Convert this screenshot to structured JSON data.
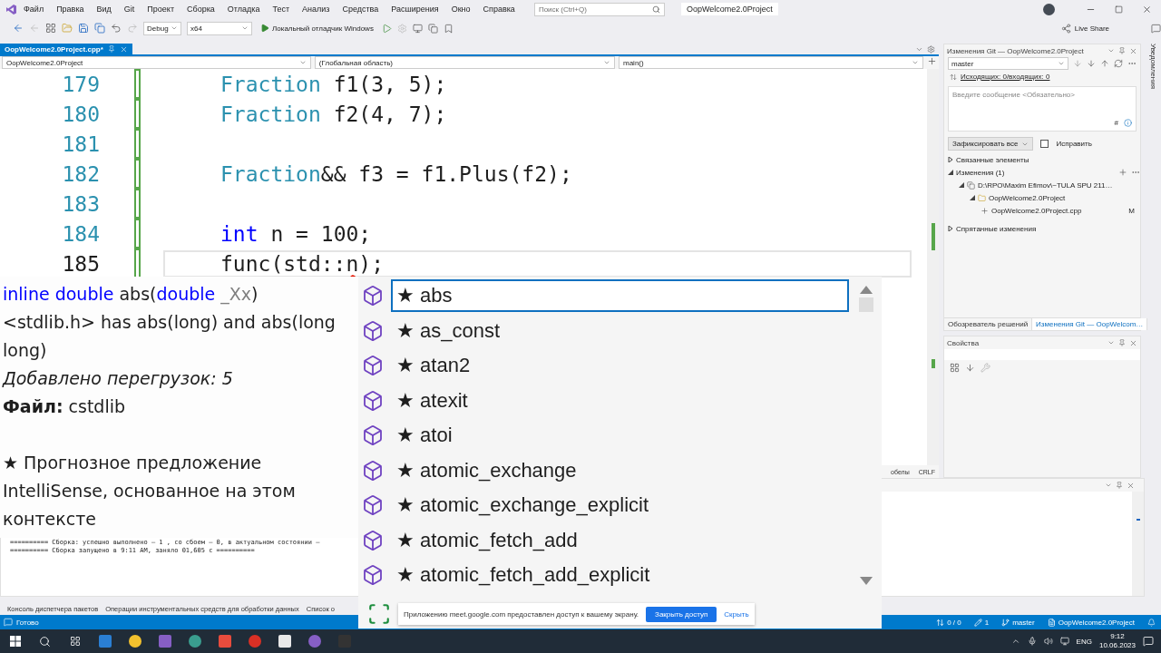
{
  "title_bar": {
    "menu": [
      "Файл",
      "Правка",
      "Вид",
      "Git",
      "Проект",
      "Сборка",
      "Отладка",
      "Тест",
      "Анализ",
      "Средства",
      "Расширения",
      "Окно",
      "Справка"
    ],
    "search": {
      "placeholder": "Поиск (Ctrl+Q)"
    },
    "project_title": "OopWelcome2.0Project"
  },
  "toolbar": {
    "configuration": "Debug",
    "platform": "x64",
    "run_target": "Локальный отладчик Windows",
    "live_share": "Live Share"
  },
  "editor": {
    "tab": {
      "label": "OopWelcome2.0Project.cpp*",
      "selected": true
    },
    "nav": [
      "OopWelcome2.0Project",
      "(Глобальная область)",
      "main()"
    ],
    "lines": [
      {
        "number": "179",
        "current": false,
        "tokens": [
          {
            "kind": "type",
            "text": "Fraction"
          },
          {
            "kind": "plain",
            "text": " f1(3, 5);"
          }
        ]
      },
      {
        "number": "180",
        "current": false,
        "tokens": [
          {
            "kind": "type",
            "text": "Fraction"
          },
          {
            "kind": "plain",
            "text": " f2(4, 7);"
          }
        ]
      },
      {
        "number": "181",
        "current": false
      },
      {
        "number": "182",
        "current": false,
        "tokens": [
          {
            "kind": "type",
            "text": "Fraction"
          },
          {
            "kind": "plain",
            "text": "&& f3 = f1.Plus(f2);"
          }
        ]
      },
      {
        "number": "183",
        "current": false
      },
      {
        "number": "184",
        "current": false,
        "tokens": [
          {
            "kind": "keyword",
            "text": "int"
          },
          {
            "kind": "plain",
            "text": " n = 100;"
          }
        ]
      },
      {
        "number": "185",
        "current": true,
        "tokens": [
          {
            "kind": "plain",
            "text": "func(std::"
          },
          {
            "kind": "error",
            "text": "n"
          },
          {
            "kind": "plain",
            "text": ");"
          }
        ]
      }
    ],
    "footer": [
      "обелы",
      "CRLF"
    ]
  },
  "intellisense": {
    "signature": [
      {
        "kind": "keyword",
        "text": "inline double"
      },
      {
        "kind": "name",
        "text": " abs("
      },
      {
        "kind": "keyword",
        "text": "double"
      },
      {
        "kind": "param",
        "text": " _Xx"
      },
      {
        "kind": "name",
        "text": ")"
      }
    ],
    "description": "<stdlib.h> has abs(long) and abs(long long)",
    "overloads": "Добавлено перегрузок: 5",
    "file": "**Файл:** cstdlib",
    "note": "★ Прогнозное предложение IntelliSense, основанное на этом контексте",
    "items": [
      {
        "label": "★ abs",
        "selected": true
      },
      {
        "label": "★ as_const",
        "selected": false
      },
      {
        "label": "★ atan2",
        "selected": false
      },
      {
        "label": "★ atexit",
        "selected": false
      },
      {
        "label": "★ atoi",
        "selected": false
      },
      {
        "label": "★ atomic_exchange",
        "selected": false
      },
      {
        "label": "★ atomic_exchange_explicit",
        "selected": false
      },
      {
        "label": "★ atomic_fetch_add",
        "selected": false
      },
      {
        "label": "★ atomic_fetch_add_explicit",
        "selected": false
      }
    ]
  },
  "git_changes": {
    "title": "Изменения Git — OopWelcome2.0Project",
    "branch": "master",
    "outgoing": "Исходящих: 0/входящих: 0",
    "message": {
      "placeholder": "Введите сообщение <Обязательно>"
    },
    "hash": "#",
    "commit": "Зафиксировать все",
    "amend": {
      "label": "Исправить",
      "checked": false
    },
    "tree": [
      {
        "label": "Связанные элементы",
        "expanded": false
      },
      {
        "label": "Изменения (1)",
        "expanded": true,
        "children": [
          {
            "label": "D:\\RPO\\Maxim Efimov\\~TULA SPU 211…",
            "kind": "repo",
            "expanded": true,
            "children": [
              {
                "label": "OopWelcome2.0Project",
                "kind": "folder",
                "expanded": true,
                "children": [
                  {
                    "label": "OopWelcome2.0Project.cpp",
                    "kind": "file",
                    "status": "M"
                  }
                ]
              }
            ]
          }
        ]
      },
      {
        "label": "Спрятанные изменения",
        "expanded": false
      }
    ],
    "tabs": [
      {
        "label": "Обозреватель решений",
        "selected": false
      },
      {
        "label": "Изменения Git — OopWelcom…",
        "selected": true
      }
    ]
  },
  "properties": {
    "title": "Свойства"
  },
  "notifications": {
    "label": "Уведомления"
  },
  "output": {
    "lines": [
      "========== Сборка: успешно выполнено — 1 , со сбоем — 0, в актуальном состоянии —",
      "========== Сборка запущено в 9:11 AM, заняло 01,605 с =========="
    ]
  },
  "bottom_tabs": [
    "Консоль диспетчера пакетов",
    "Операции инструментальных средств для обработки данных",
    "Список о"
  ],
  "status_bar": {
    "state": "Готово",
    "items": [
      {
        "kind": "sync",
        "text": "0 / 0"
      },
      {
        "kind": "edits",
        "text": "1"
      },
      {
        "kind": "branch",
        "text": "master"
      },
      {
        "kind": "repo",
        "text": "OopWelcome2.0Project"
      }
    ]
  },
  "screen_share": {
    "message": "Приложению meet.google.com предоставлен доступ к вашему экрану.",
    "stop": "Закрыть доступ",
    "hide": "Скрыть"
  },
  "taskbar": {
    "language": "ENG",
    "time": "9:12",
    "date": "10.06.2023"
  }
}
